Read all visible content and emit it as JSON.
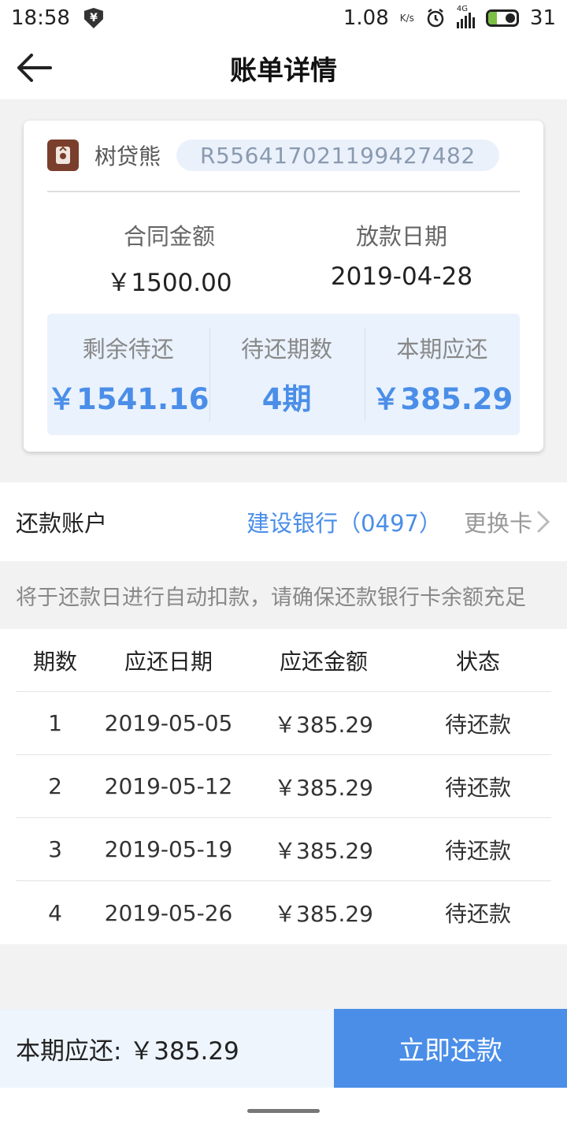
{
  "status_bar": {
    "time": "18:58",
    "shield_glyph": "¥",
    "net_speed": "1.08",
    "net_speed_unit": "K/s",
    "signal_label": "4G",
    "battery": "31",
    "icons": [
      "shield-icon",
      "alarm-icon",
      "signal-icon",
      "battery-icon"
    ]
  },
  "nav": {
    "title": "账单详情",
    "back_icon": "arrow-left-icon"
  },
  "loan_card": {
    "lender_name": "树贷熊",
    "order_no": "R556417021199427482",
    "contract_amount_label": "合同金额",
    "contract_amount": "￥1500.00",
    "disburse_date_label": "放款日期",
    "disburse_date": "2019-04-28",
    "summary": [
      {
        "label": "剩余待还",
        "value": "￥1541.16"
      },
      {
        "label": "待还期数",
        "value": "4期"
      },
      {
        "label": "本期应还",
        "value": "￥385.29"
      }
    ]
  },
  "repay_account": {
    "label": "还款账户",
    "bank": "建设银行（0497）",
    "change_label": "更换卡"
  },
  "notice": "将于还款日进行自动扣款，请确保还款银行卡余额充足",
  "schedule": {
    "headers": [
      "期数",
      "应还日期",
      "应还金额",
      "状态"
    ],
    "rows": [
      [
        "1",
        "2019-05-05",
        "￥385.29",
        "待还款"
      ],
      [
        "2",
        "2019-05-12",
        "￥385.29",
        "待还款"
      ],
      [
        "3",
        "2019-05-19",
        "￥385.29",
        "待还款"
      ],
      [
        "4",
        "2019-05-26",
        "￥385.29",
        "待还款"
      ]
    ]
  },
  "bottom_bar": {
    "due_label": "本期应还: ￥385.29",
    "pay_button": "立即还款"
  },
  "colors": {
    "accent": "#4a8ee8",
    "summary_bg": "#eaf2fd",
    "logo_bg": "#7a3e2c"
  }
}
